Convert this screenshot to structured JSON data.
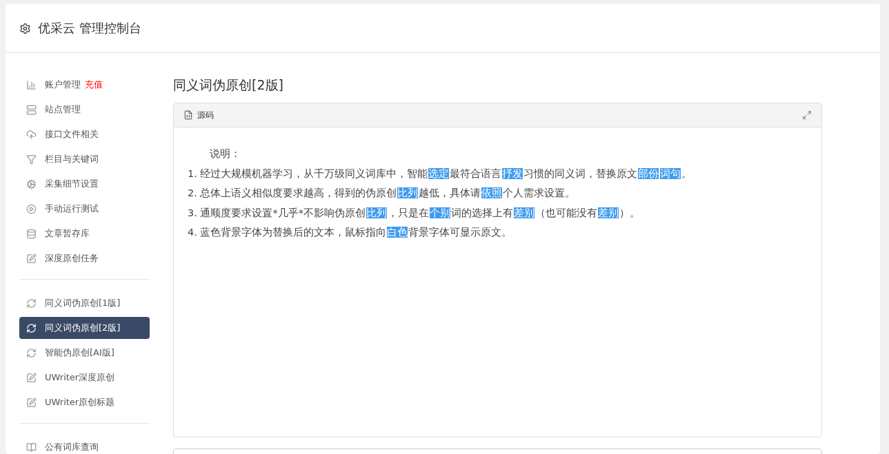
{
  "header": {
    "title": "优采云 管理控制台"
  },
  "sidebar": {
    "groups": [
      {
        "items": [
          {
            "kind": "chart",
            "label": "账户管理",
            "badge": "充值",
            "selected": false
          },
          {
            "kind": "server",
            "label": "站点管理",
            "selected": false
          },
          {
            "kind": "cloud",
            "label": "接口文件相关",
            "selected": false
          },
          {
            "kind": "filter",
            "label": "栏目与关键词",
            "selected": false
          },
          {
            "kind": "cogs",
            "label": "采集细节设置",
            "selected": false
          },
          {
            "kind": "play",
            "label": "手动运行测试",
            "selected": false
          },
          {
            "kind": "database",
            "label": "文章暂存库",
            "selected": false
          },
          {
            "kind": "edit",
            "label": "深度原创任务",
            "selected": false
          }
        ]
      },
      {
        "items": [
          {
            "kind": "refresh",
            "label": "同义词伪原创[1版]",
            "selected": false
          },
          {
            "kind": "refresh",
            "label": "同义词伪原创[2版]",
            "selected": true
          },
          {
            "kind": "refresh",
            "label": "智能伪原创[AI版]",
            "selected": false
          },
          {
            "kind": "edit",
            "label": "UWriter深度原创",
            "selected": false
          },
          {
            "kind": "edit",
            "label": "UWriter原创标题",
            "selected": false
          }
        ]
      },
      {
        "items": [
          {
            "kind": "book",
            "label": "公有词库查询",
            "selected": false
          }
        ]
      }
    ]
  },
  "content": {
    "title": "同义词伪原创[2版]",
    "panel": {
      "tab": "源码",
      "heading": "说明：",
      "lines": [
        [
          {
            "text": "1. 经过大规模机器学习，从千万级同义词库中，智能",
            "highlighted": false
          },
          {
            "text": "选定",
            "highlighted": true
          },
          {
            "text": "最符合语言",
            "highlighted": false
          },
          {
            "text": "抒发",
            "highlighted": true
          },
          {
            "text": "习惯的同义词，替换原文",
            "highlighted": false
          },
          {
            "text": "部份",
            "highlighted": true
          },
          {
            "text": "词句",
            "highlighted": true
          },
          {
            "text": "。",
            "highlighted": false
          }
        ],
        [
          {
            "text": "2. 总体上语义相似度要求越高，得到的伪原创",
            "highlighted": false
          },
          {
            "text": "比列",
            "highlighted": true
          },
          {
            "text": "越低，具体请",
            "highlighted": false
          },
          {
            "text": "依照",
            "highlighted": true
          },
          {
            "text": "个人需求设置。",
            "highlighted": false
          }
        ],
        [
          {
            "text": "3. 通顺度要求设置*几乎*不影响伪原创",
            "highlighted": false
          },
          {
            "text": "比列",
            "highlighted": true
          },
          {
            "text": "，只是在",
            "highlighted": false
          },
          {
            "text": "个别",
            "highlighted": true
          },
          {
            "text": "词的选择上有",
            "highlighted": false
          },
          {
            "text": "差别",
            "highlighted": true
          },
          {
            "text": "（也可能没有",
            "highlighted": false
          },
          {
            "text": "差别",
            "highlighted": true
          },
          {
            "text": "）。",
            "highlighted": false
          }
        ],
        [
          {
            "text": "4. 蓝色背景字体为替换后的文本，鼠标指向",
            "highlighted": false
          },
          {
            "text": "白色",
            "highlighted": true
          },
          {
            "text": "背景字体可显示原文。",
            "highlighted": false
          }
        ]
      ]
    }
  }
}
